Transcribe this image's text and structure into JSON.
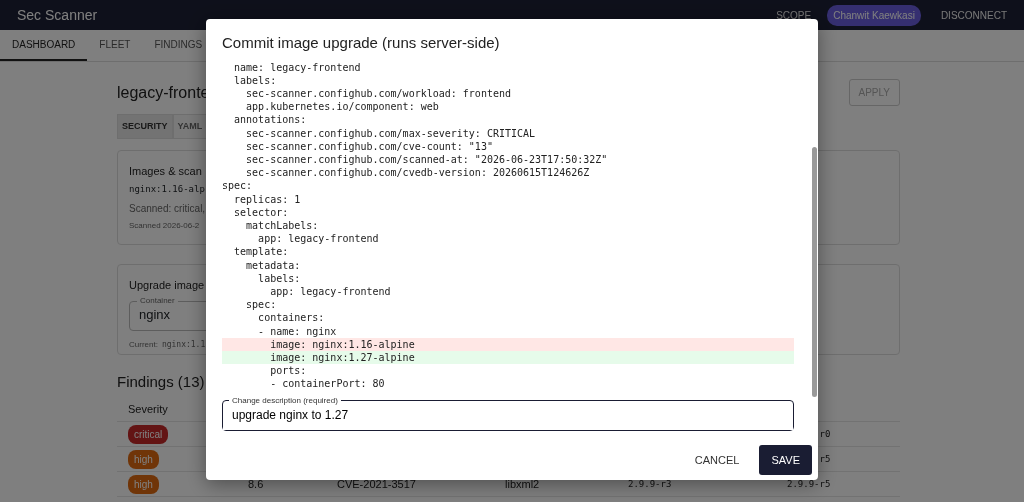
{
  "navbar": {
    "brand": "Sec Scanner",
    "links": [
      "SCOPE"
    ],
    "user": "Chanwit Kaewkasi",
    "action": "DISCONNECT"
  },
  "nav_tabs": [
    {
      "label": "DASHBOARD",
      "selected": true
    },
    {
      "label": "FLEET",
      "selected": false
    },
    {
      "label": "FINDINGS",
      "selected": false
    }
  ],
  "workload": {
    "title": "legacy-fronte",
    "apply_button": {
      "label": "APPLY",
      "disabled": true
    }
  },
  "view_tabs": [
    {
      "label": "SECURITY",
      "selected": true
    },
    {
      "label": "YAML",
      "selected": false
    }
  ],
  "images_card": {
    "title": "Images & scan",
    "image": "nginx:1.16-alp",
    "scanned": "Scanned: critical,",
    "scan_time": "Scanned 2026-06-2"
  },
  "upgrade_card": {
    "title": "Upgrade image",
    "container_label": "Container",
    "container_value": "nginx",
    "current_label": "Current:",
    "current_image": "nginx:1.1"
  },
  "findings": {
    "heading": "Findings (13)",
    "columns": [
      "Severity"
    ],
    "rows": [
      {
        "severity": {
          "label": "critical",
          "kind": "critical"
        },
        "fixed": "r0"
      },
      {
        "severity": {
          "label": "high",
          "kind": "high"
        },
        "fixed": "r5"
      },
      {
        "severity": {
          "label": "high",
          "kind": "high"
        },
        "score": "8.6",
        "cve": "CVE-2021-3517",
        "package": "libxml2",
        "installed": "2.9.9-r3",
        "fixed": "2.9.9-r5"
      }
    ]
  },
  "dialog": {
    "title": "Commit image upgrade (runs server-side)",
    "yaml_lines": [
      {
        "text": "  name: legacy-frontend",
        "kind": "context"
      },
      {
        "text": "  labels:",
        "kind": "context"
      },
      {
        "text": "    sec-scanner.confighub.com/workload: frontend",
        "kind": "context"
      },
      {
        "text": "    app.kubernetes.io/component: web",
        "kind": "context"
      },
      {
        "text": "  annotations:",
        "kind": "context"
      },
      {
        "text": "    sec-scanner.confighub.com/max-severity: CRITICAL",
        "kind": "context"
      },
      {
        "text": "    sec-scanner.confighub.com/cve-count: \"13\"",
        "kind": "context"
      },
      {
        "text": "    sec-scanner.confighub.com/scanned-at: \"2026-06-23T17:50:32Z\"",
        "kind": "context"
      },
      {
        "text": "    sec-scanner.confighub.com/cvedb-version: 20260615T124626Z",
        "kind": "context"
      },
      {
        "text": "spec:",
        "kind": "context"
      },
      {
        "text": "  replicas: 1",
        "kind": "context"
      },
      {
        "text": "  selector:",
        "kind": "context"
      },
      {
        "text": "    matchLabels:",
        "kind": "context"
      },
      {
        "text": "      app: legacy-frontend",
        "kind": "context"
      },
      {
        "text": "  template:",
        "kind": "context"
      },
      {
        "text": "    metadata:",
        "kind": "context"
      },
      {
        "text": "      labels:",
        "kind": "context"
      },
      {
        "text": "        app: legacy-frontend",
        "kind": "context"
      },
      {
        "text": "    spec:",
        "kind": "context"
      },
      {
        "text": "      containers:",
        "kind": "context"
      },
      {
        "text": "      - name: nginx",
        "kind": "context"
      },
      {
        "text": "        image: nginx:1.16-alpine",
        "kind": "removed"
      },
      {
        "text": "        image: nginx:1.27-alpine",
        "kind": "added"
      },
      {
        "text": "        ports:",
        "kind": "context"
      },
      {
        "text": "        - containerPort: 80",
        "kind": "context"
      }
    ],
    "description": {
      "label": "Change description (required)",
      "value": "upgrade nginx to 1.27"
    },
    "buttons": [
      {
        "label": "CANCEL",
        "kind": "text"
      },
      {
        "label": "SAVE",
        "kind": "primary"
      }
    ]
  }
}
